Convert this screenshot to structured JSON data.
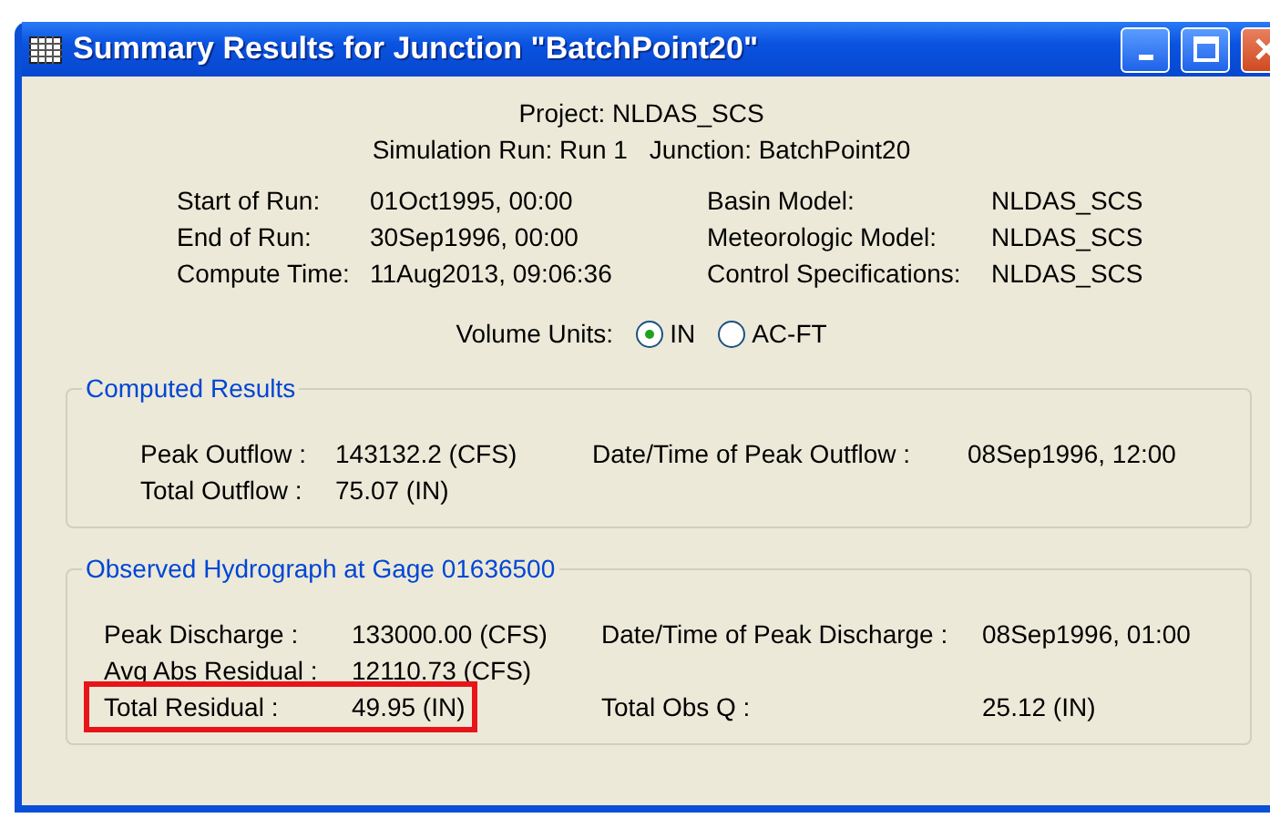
{
  "window": {
    "title": "Summary Results for Junction \"BatchPoint20\""
  },
  "header": {
    "project": "Project: NLDAS_SCS",
    "simulation_run": "Simulation Run: Run 1",
    "junction": "Junction: BatchPoint20"
  },
  "run_info": [
    {
      "label": "Start of Run:",
      "value": "01Oct1995, 00:00",
      "label_2": "Basin Model:",
      "value_2": "NLDAS_SCS"
    },
    {
      "label": "End of Run:",
      "value": "30Sep1996, 00:00",
      "label_2": "Meteorologic Model:",
      "value_2": "NLDAS_SCS"
    },
    {
      "label": "Compute Time:",
      "value": "11Aug2013, 09:06:36",
      "label_2": "Control Specifications:",
      "value_2": "NLDAS_SCS"
    }
  ],
  "volume_units": {
    "label": "Volume Units:",
    "options": [
      {
        "label": "IN",
        "selected": true
      },
      {
        "label": "AC-FT",
        "selected": false
      }
    ]
  },
  "computed_results": {
    "title": "Computed Results",
    "rows": [
      {
        "label": "Peak Outflow :",
        "value": "143132.2 (CFS)",
        "label_2": "Date/Time of Peak Outflow :",
        "value_2": "08Sep1996, 12:00"
      },
      {
        "label": "Total Outflow :",
        "value": "75.07 (IN)"
      }
    ]
  },
  "observed_hydrograph": {
    "title": "Observed Hydrograph at Gage 01636500",
    "rows": [
      {
        "label": "Peak Discharge :",
        "value": "133000.00 (CFS)",
        "label_2": "Date/Time of Peak Discharge :",
        "value_2": "08Sep1996, 01:00",
        "highlighted": false
      },
      {
        "label": "Avg Abs Residual :",
        "value": "12110.73 (CFS)",
        "highlighted": false
      },
      {
        "label": "Total Residual :",
        "value": "49.95 (IN)",
        "label_2": "Total Obs Q :",
        "value_2": "25.12 (IN)",
        "highlighted": true
      }
    ]
  }
}
